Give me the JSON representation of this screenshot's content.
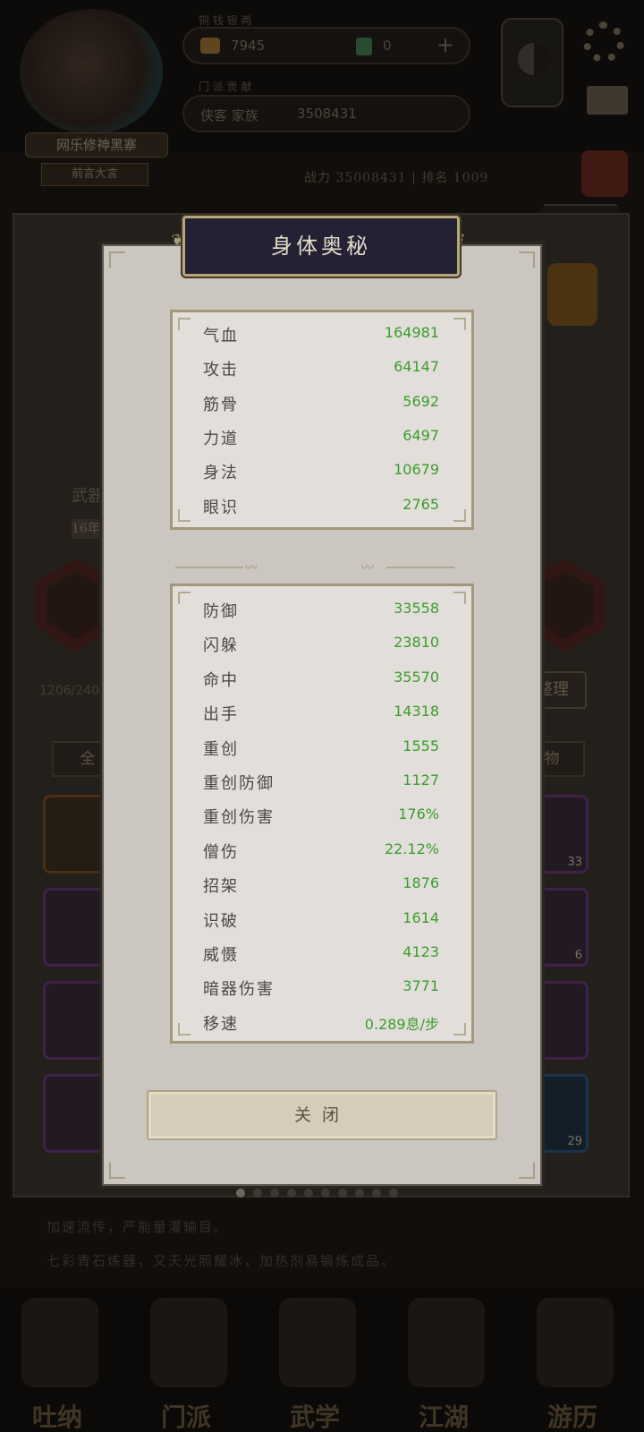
{
  "background": {
    "player_name": "网乐修神黑寨",
    "player_sub": "前言大言",
    "resource_label_1": "铜 钱 银 两",
    "currency_value": "7945",
    "jade_value": "0",
    "resource_label_2": "门 派 贡 献",
    "clan_label": "侠客 家族",
    "clan_value": "3508431",
    "stat_strip": "战力 35008431 | 排名 1009",
    "capacity": "1206/240",
    "name_bar": "武器",
    "level_badge": "16年",
    "sort_button": "整理",
    "filter_all": "全",
    "filter_item": "物",
    "close_button": "关闭",
    "desc_line_1": "加速流传，严能量灌输目。",
    "desc_line_2": "七彩青石炼器，又天光照耀冰，加热剂易锻炼成品。",
    "counts": {
      "c1": "33",
      "c2": "6",
      "c3": "29"
    },
    "nav": [
      {
        "label": "吐纳"
      },
      {
        "label": "门派"
      },
      {
        "label": "武学"
      },
      {
        "label": "江湖"
      },
      {
        "label": "游历"
      }
    ]
  },
  "modal": {
    "title": "身体奥秘",
    "primary_stats": [
      {
        "name": "气血",
        "value": "164981"
      },
      {
        "name": "攻击",
        "value": "64147"
      },
      {
        "name": "筋骨",
        "value": "5692"
      },
      {
        "name": "力道",
        "value": "6497"
      },
      {
        "name": "身法",
        "value": "10679"
      },
      {
        "name": "眼识",
        "value": "2765"
      }
    ],
    "secondary_stats": [
      {
        "name": "防御",
        "value": "33558"
      },
      {
        "name": "闪躲",
        "value": "23810"
      },
      {
        "name": "命中",
        "value": "35570"
      },
      {
        "name": "出手",
        "value": "14318"
      },
      {
        "name": "重创",
        "value": "1555"
      },
      {
        "name": "重创防御",
        "value": "1127"
      },
      {
        "name": "重创伤害",
        "value": "176%"
      },
      {
        "name": "僧伤",
        "value": "22.12%"
      },
      {
        "name": "招架",
        "value": "1876"
      },
      {
        "name": "识破",
        "value": "1614"
      },
      {
        "name": "威慑",
        "value": "4123"
      },
      {
        "name": "暗器伤害",
        "value": "3771"
      },
      {
        "name": "移速",
        "value": "0.289息/步"
      }
    ],
    "close_label": "关闭"
  },
  "pager": {
    "count": 10,
    "active_index": 0
  }
}
